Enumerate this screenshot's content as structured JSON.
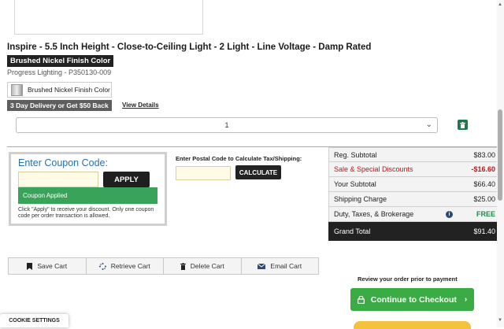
{
  "product": {
    "title": "Inspire - 5.5 Inch Height - Close-to-Ceiling Light - 2 Light - Line Voltage - Damp Rated",
    "finish_badge": "Brushed Nickel Finish Color",
    "sku": "Progress Lighting - P350130-009",
    "swatch_label": "Brushed Nickel Finish Color",
    "delivery_badge": "3 Day Delivery or Get $50 Back",
    "view_details": "View Details",
    "quantity": "1"
  },
  "coupon": {
    "title": "Enter Coupon Code:",
    "input_value": "",
    "apply_label": "APPLY",
    "applied_message": "Coupon Applied",
    "note": "Click \"Apply\" to receive your discount. Only one coupon code per order transaction is allowed."
  },
  "shipping": {
    "label": "Enter Postal Code to Calculate Tax/Shipping:",
    "input_value": "",
    "calculate_label": "CALCULATE"
  },
  "summary": {
    "reg_subtotal_label": "Reg. Subtotal",
    "reg_subtotal": "$83.00",
    "discount_label": "Sale & Special Discounts",
    "discount": "-$16.60",
    "your_subtotal_label": "Your Subtotal",
    "your_subtotal": "$66.40",
    "shipping_label": "Shipping Charge",
    "shipping": "$25.00",
    "duty_label": "Duty, Taxes, & Brokerage",
    "duty_info": "i",
    "duty": "FREE",
    "total_label": "Grand Total",
    "total": "$91.40"
  },
  "cart_actions": {
    "save": "Save Cart",
    "retrieve": "Retrieve Cart",
    "delete": "Delete Cart",
    "email": "Email Cart"
  },
  "checkout": {
    "review_note": "Review your order prior to payment",
    "button_label": "Continue to Checkout",
    "chevron": "›"
  },
  "cookie_settings": "COOKIE SETTINGS",
  "icons": {
    "quantity_chevron": "⌄",
    "scroll_up": "▲",
    "scroll_down": "▼"
  },
  "colors": {
    "checkout_green": "#3bab45",
    "coupon_applied_green": "#3aa35a",
    "discount_red": "#b51a1a",
    "coupon_title_blue": "#2a6fb0"
  }
}
